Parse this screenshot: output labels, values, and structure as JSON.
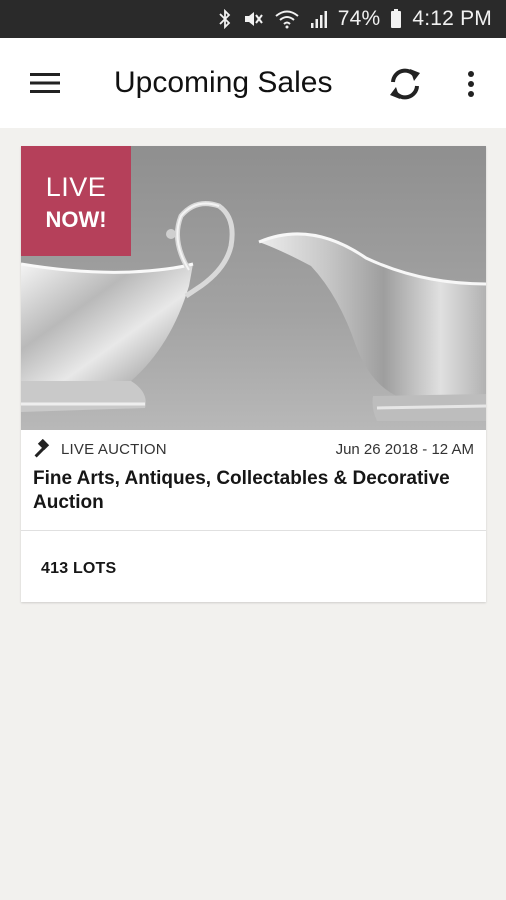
{
  "status_bar": {
    "icons": [
      "bluetooth-icon",
      "vibrate-mute-icon",
      "wifi-icon",
      "signal-icon",
      "battery-icon"
    ],
    "battery": "74%",
    "time": "4:12 PM"
  },
  "app_bar": {
    "title": "Upcoming Sales",
    "icons": [
      "hamburger-menu-icon",
      "refresh-icon",
      "more-vert-icon"
    ]
  },
  "sale": {
    "badge_line1": "LIVE",
    "badge_line2": "NOW!",
    "badge_color": "#b5405a",
    "type": "LIVE AUCTION",
    "type_icon": "gavel-icon",
    "date": "Jun 26 2018 - 12 AM",
    "title": "Fine Arts, Antiques, Collectables & Decorative Auction",
    "lots": "413 LOTS",
    "image": "two silver sauce boats on grey background"
  }
}
